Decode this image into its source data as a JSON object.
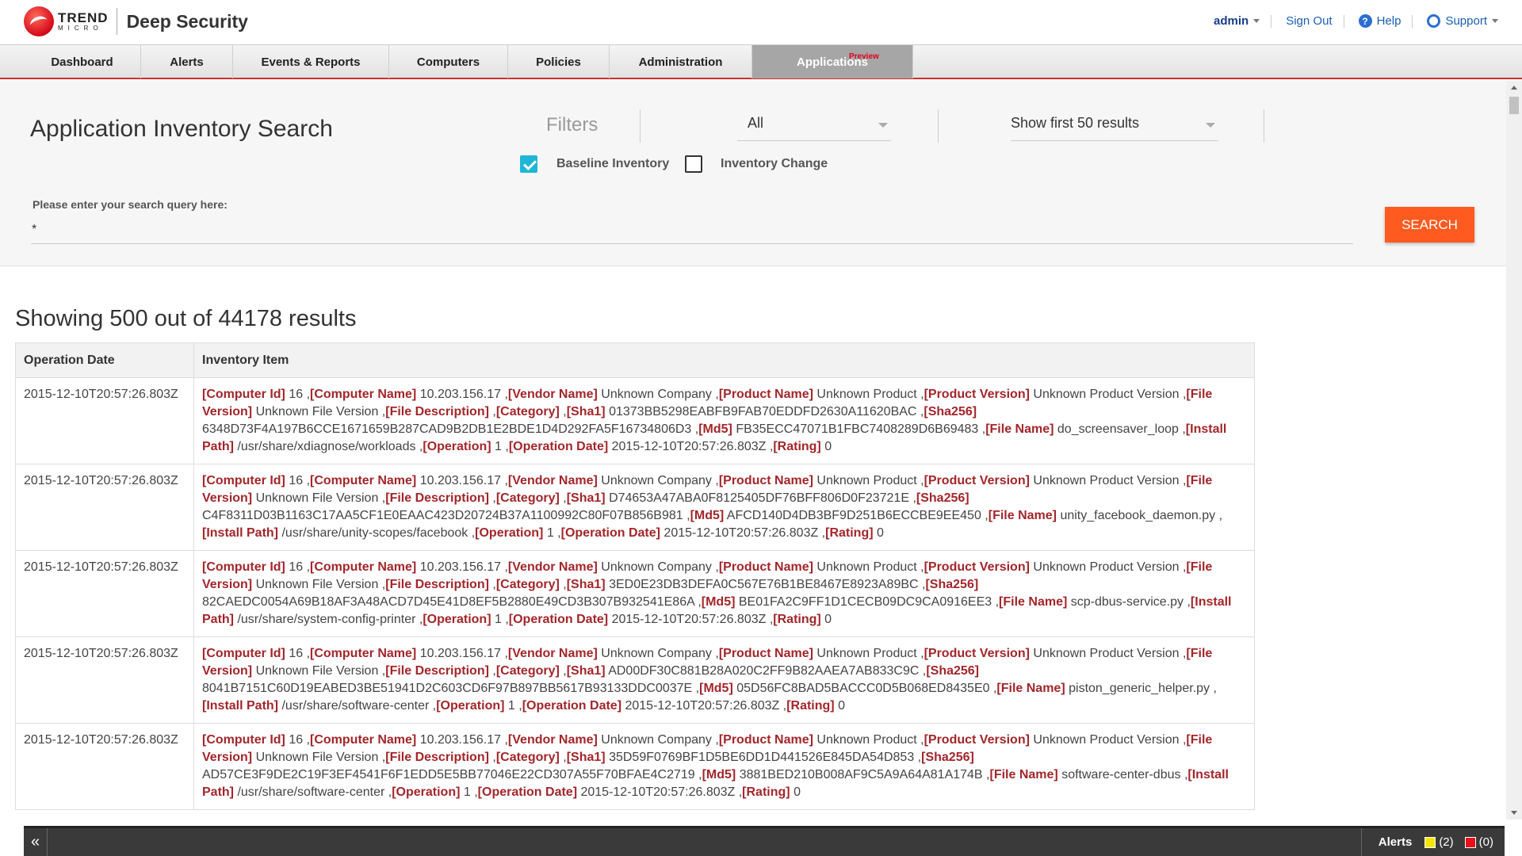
{
  "header": {
    "logo_trend": "TREND",
    "logo_micro": "MICRO",
    "product": "Deep Security",
    "user": "admin",
    "sign_out": "Sign Out",
    "help": "Help",
    "support": "Support"
  },
  "nav": {
    "items": [
      "Dashboard",
      "Alerts",
      "Events & Reports",
      "Computers",
      "Policies",
      "Administration",
      "Applications"
    ],
    "preview_badge": "Preview",
    "active": "Applications"
  },
  "search": {
    "title": "Application Inventory Search",
    "filters_label": "Filters",
    "filter_value": "All",
    "results_limit_value": "Show first 50 results",
    "baseline_label": "Baseline Inventory",
    "baseline_checked": true,
    "change_label": "Inventory Change",
    "change_checked": false,
    "query_label": "Please enter your search query here:",
    "query_value": "*",
    "button": "SEARCH"
  },
  "results": {
    "summary": "Showing 500 out of 44178 results",
    "columns": [
      "Operation Date",
      "Inventory Item"
    ],
    "rows": [
      {
        "date": "2015-12-10T20:57:26.803Z",
        "computer_id": "16",
        "computer_name": "10.203.156.17",
        "vendor_name": "Unknown Company",
        "product_name": "Unknown Product",
        "product_version": "Unknown Product Version",
        "file_version": "Unknown File Version",
        "sha1": "01373BB5298EABFB9FAB70EDDFD2630A11620BAC",
        "sha256": "6348D73F4A197B6CCE1671659B287CAD9B2DB1E2BDE1D4D292FA5F16734806D3",
        "md5": "FB35ECC47071B1FBC7408289D6B69483",
        "file_name": "do_screensaver_loop",
        "install_path": "/usr/share/xdiagnose/workloads",
        "operation": "1",
        "operation_date": "2015-12-10T20:57:26.803Z",
        "rating": "0"
      },
      {
        "date": "2015-12-10T20:57:26.803Z",
        "computer_id": "16",
        "computer_name": "10.203.156.17",
        "vendor_name": "Unknown Company",
        "product_name": "Unknown Product",
        "product_version": "Unknown Product Version",
        "file_version": "Unknown File Version",
        "sha1": "D74653A47ABA0F8125405DF76BFF806D0F23721E",
        "sha256": "C4F8311D03B1163C17AA5CF1E0EAAC423D20724B37A1100992C80F07B856B981",
        "md5": "AFCD140D4DB3BF9D251B6ECCBE9EE450",
        "file_name": "unity_facebook_daemon.py",
        "install_path": "/usr/share/unity-scopes/facebook",
        "operation": "1",
        "operation_date": "2015-12-10T20:57:26.803Z",
        "rating": "0"
      },
      {
        "date": "2015-12-10T20:57:26.803Z",
        "computer_id": "16",
        "computer_name": "10.203.156.17",
        "vendor_name": "Unknown Company",
        "product_name": "Unknown Product",
        "product_version": "Unknown Product Version",
        "file_version": "Unknown File Version",
        "sha1": "3ED0E23DB3DEFA0C567E76B1BE8467E8923A89BC",
        "sha256": "82CAEDC0054A69B18AF3A48ACD7D45E41D8EF5B2880E49CD3B307B932541E86A",
        "md5": "BE01FA2C9FF1D1CECB09DC9CA0916EE3",
        "file_name": "scp-dbus-service.py",
        "install_path": "/usr/share/system-config-printer",
        "operation": "1",
        "operation_date": "2015-12-10T20:57:26.803Z",
        "rating": "0"
      },
      {
        "date": "2015-12-10T20:57:26.803Z",
        "computer_id": "16",
        "computer_name": "10.203.156.17",
        "vendor_name": "Unknown Company",
        "product_name": "Unknown Product",
        "product_version": "Unknown Product Version",
        "file_version": "Unknown File Version",
        "sha1": "AD00DF30C881B28A020C2FF9B82AAEA7AB833C9C",
        "sha256": "8041B7151C60D19EABED3BE51941D2C603CD6F97B897BB5617B93133DDC0037E",
        "md5": "05D56FC8BAD5BACCC0D5B068ED8435E0",
        "file_name": "piston_generic_helper.py",
        "install_path": "/usr/share/software-center",
        "operation": "1",
        "operation_date": "2015-12-10T20:57:26.803Z",
        "rating": "0"
      },
      {
        "date": "2015-12-10T20:57:26.803Z",
        "computer_id": "16",
        "computer_name": "10.203.156.17",
        "vendor_name": "Unknown Company",
        "product_name": "Unknown Product",
        "product_version": "Unknown Product Version",
        "file_version": "Unknown File Version",
        "sha1": "35D59F0769BF1D5BE6DD1D441526E845DA54D853",
        "sha256": "AD57CE3F9DE2C19F3EF4541F6F1EDD5E5BB77046E22CD307A55F70BFAE4C2719",
        "md5": "3881BED210B008AF9C5A9A64A81A174B",
        "file_name": "software-center-dbus",
        "install_path": "/usr/share/software-center",
        "operation": "1",
        "operation_date": "2015-12-10T20:57:26.803Z",
        "rating": "0"
      }
    ]
  },
  "field_labels": {
    "computer_id": "[Computer Id]",
    "computer_name": "[Computer Name]",
    "vendor_name": "[Vendor Name]",
    "product_name": "[Product Name]",
    "product_version": "[Product Version]",
    "file_version": "[File Version]",
    "file_description": "[File Description]",
    "category": "[Category]",
    "sha1": "[Sha1]",
    "sha256": "[Sha256]",
    "md5": "[Md5]",
    "file_name": "[File Name]",
    "install_path": "[Install Path]",
    "operation": "[Operation]",
    "operation_date": "[Operation Date]",
    "rating": "[Rating]"
  },
  "footer": {
    "collapse": "«",
    "alerts_label": "Alerts",
    "warning_count": "(2)",
    "critical_count": "(0)",
    "warning_color": "#f5e600",
    "critical_color": "#e8101a"
  }
}
